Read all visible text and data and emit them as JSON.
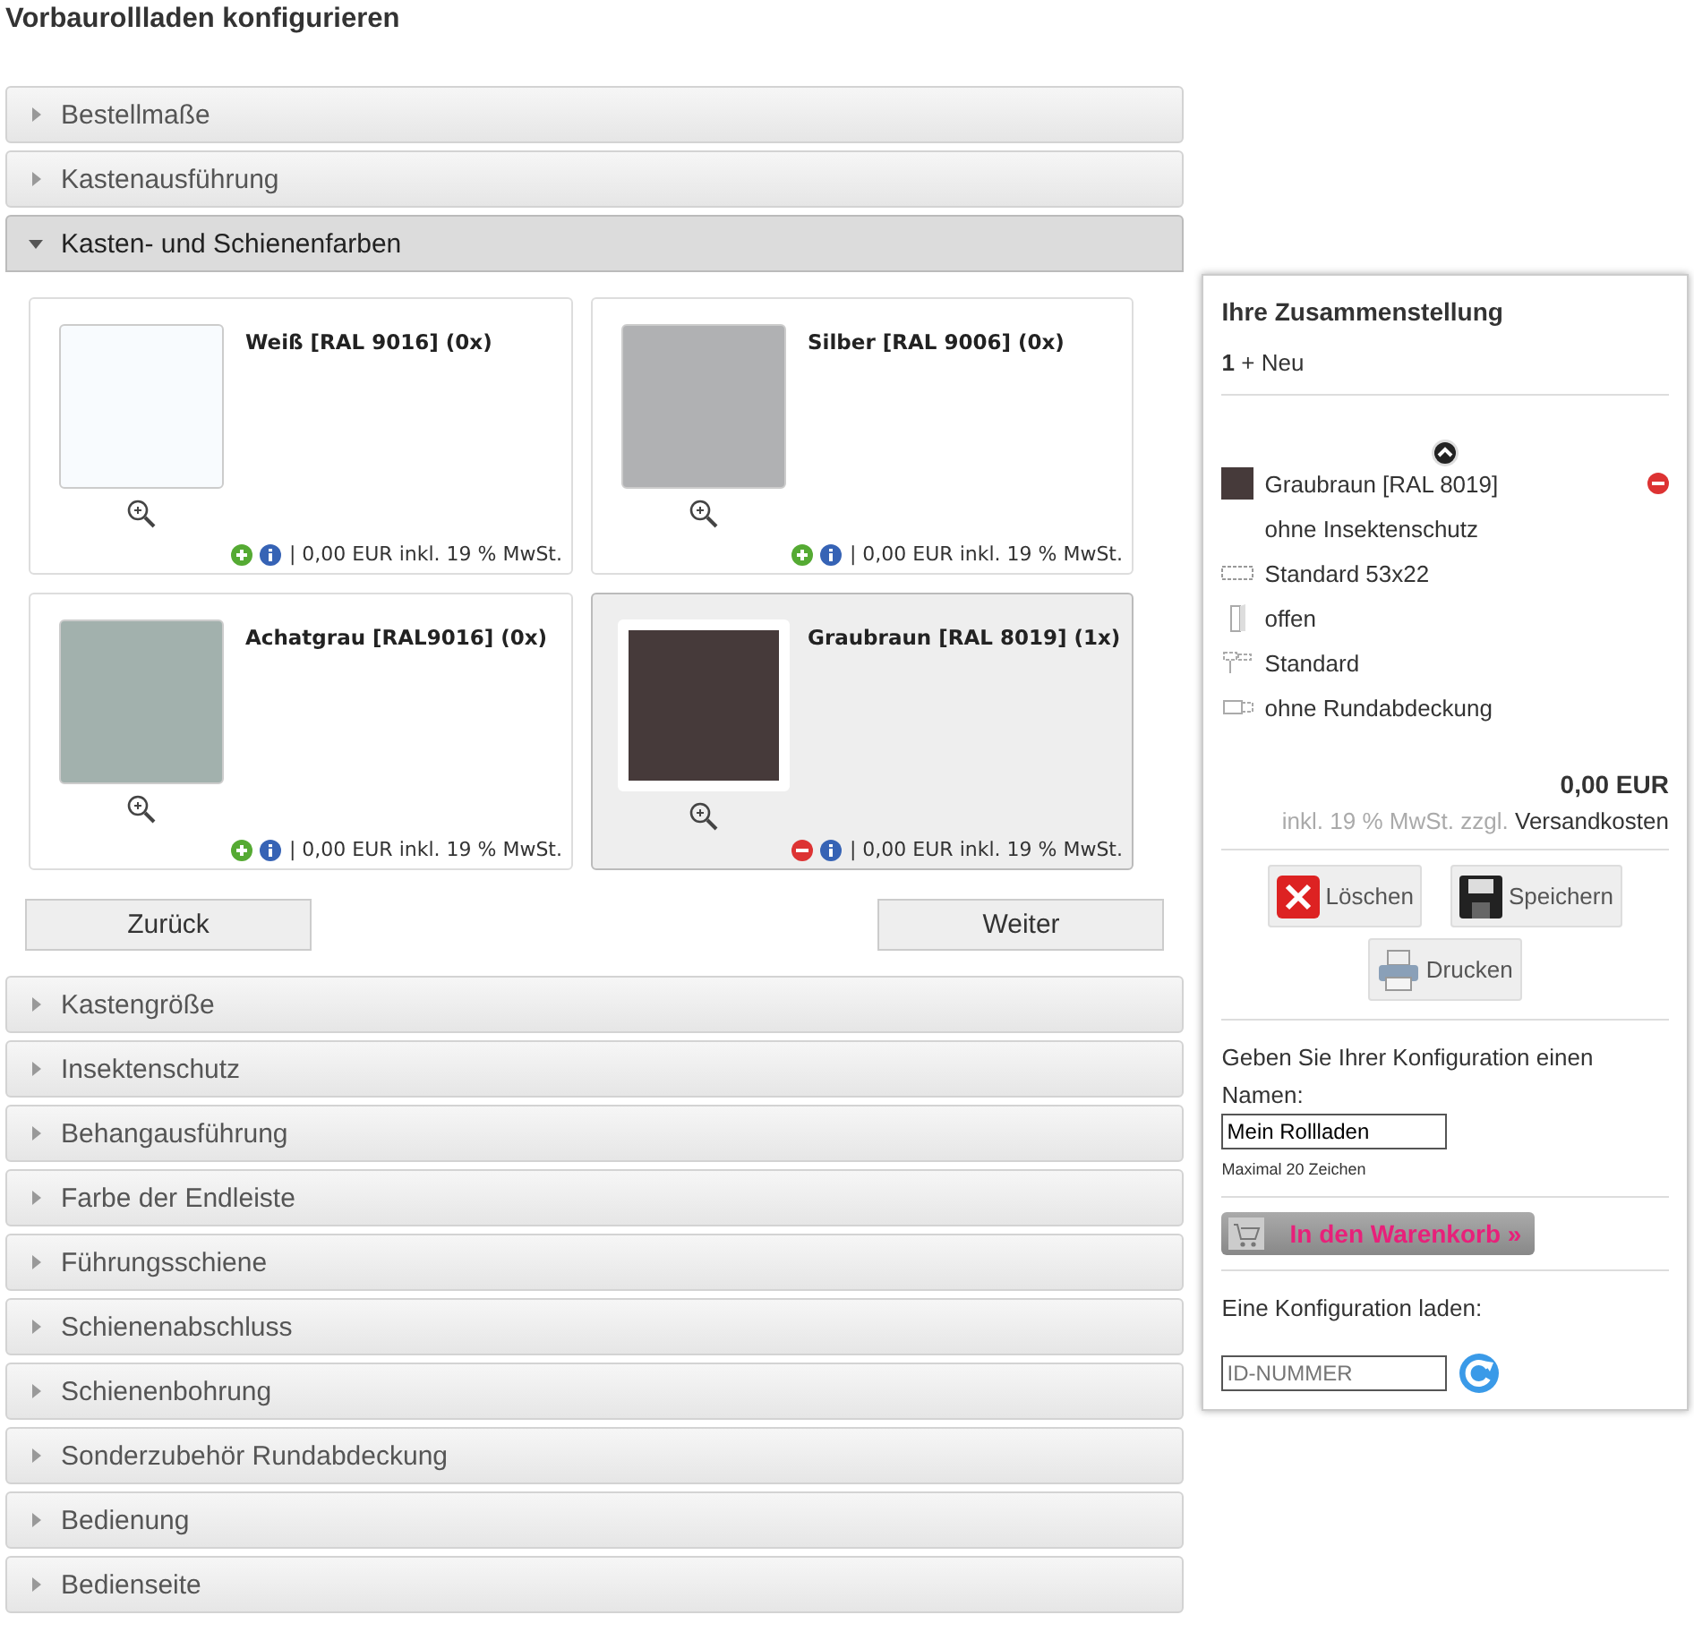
{
  "page_title": "Vorbaurollladen konfigurieren",
  "sections_before": [
    {
      "label": "Bestellmaße",
      "expanded": false
    },
    {
      "label": "Kastenausführung",
      "expanded": false
    },
    {
      "label": "Kasten- und Schienenfarben",
      "expanded": true
    }
  ],
  "colors": [
    {
      "name": "Weiß [RAL 9016] (0x)",
      "color": "#f8fbfe",
      "selected": false,
      "price": "| 0,00 EUR inkl. 19 % MwSt."
    },
    {
      "name": "Silber [RAL 9006] (0x)",
      "color": "#b0b1b3",
      "selected": false,
      "price": "| 0,00 EUR inkl. 19 % MwSt."
    },
    {
      "name": "Achatgrau [RAL9016] (0x)",
      "color": "#a2b1ad",
      "selected": false,
      "price": "| 0,00 EUR inkl. 19 % MwSt."
    },
    {
      "name": "Graubraun [RAL 8019] (1x)",
      "color": "#463a3a",
      "selected": true,
      "price": "| 0,00 EUR inkl. 19 % MwSt."
    }
  ],
  "nav_buttons": [
    "Zurück",
    "Weiter"
  ],
  "sections_after": [
    {
      "label": "Kastengröße",
      "expanded": false
    },
    {
      "label": "Insektenschutz",
      "expanded": false
    },
    {
      "label": "Behangausführung",
      "expanded": false
    },
    {
      "label": "Farbe der Endleiste",
      "expanded": false
    },
    {
      "label": "Führungsschiene",
      "expanded": false
    },
    {
      "label": "Schienenabschluss",
      "expanded": false
    },
    {
      "label": "Schienenbohrung",
      "expanded": false
    },
    {
      "label": "Sonderzubehör Rundabdeckung",
      "expanded": false
    },
    {
      "label": "Bedienung",
      "expanded": false
    },
    {
      "label": "Bedienseite",
      "expanded": false
    }
  ],
  "summary": {
    "title": "Ihre Zusammenstellung",
    "count": "1",
    "new_link": "+ Neu",
    "items": [
      {
        "kind": "swatch",
        "color": "#463a3a",
        "label": "Graubraun [RAL 8019]",
        "removable": true
      },
      {
        "kind": "blank",
        "label": "ohne Insektenschutz",
        "removable": false
      },
      {
        "kind": "box",
        "label": "Standard 53x22",
        "removable": false
      },
      {
        "kind": "door",
        "label": "offen",
        "removable": false
      },
      {
        "kind": "rail",
        "label": "Standard",
        "removable": false
      },
      {
        "kind": "cover",
        "label": "ohne Rundabdeckung",
        "removable": false
      }
    ],
    "total": "0,00 EUR",
    "tax_note": "inkl. 19 % MwSt. zzgl.",
    "shipping_link": "Versandkosten",
    "actions": [
      {
        "kind": "delete",
        "label": "Löschen"
      },
      {
        "kind": "save",
        "label": "Speichern"
      },
      {
        "kind": "print",
        "label": "Drucken"
      }
    ],
    "name_prompt": "Geben Sie Ihrer Konfiguration einen Namen:",
    "name_value": "Mein Rollladen",
    "name_hint": "Maximal 20 Zeichen",
    "cart_button": "In den Warenkorb »",
    "load_prompt": "Eine Konfiguration laden:",
    "load_placeholder": "ID-NUMMER"
  }
}
